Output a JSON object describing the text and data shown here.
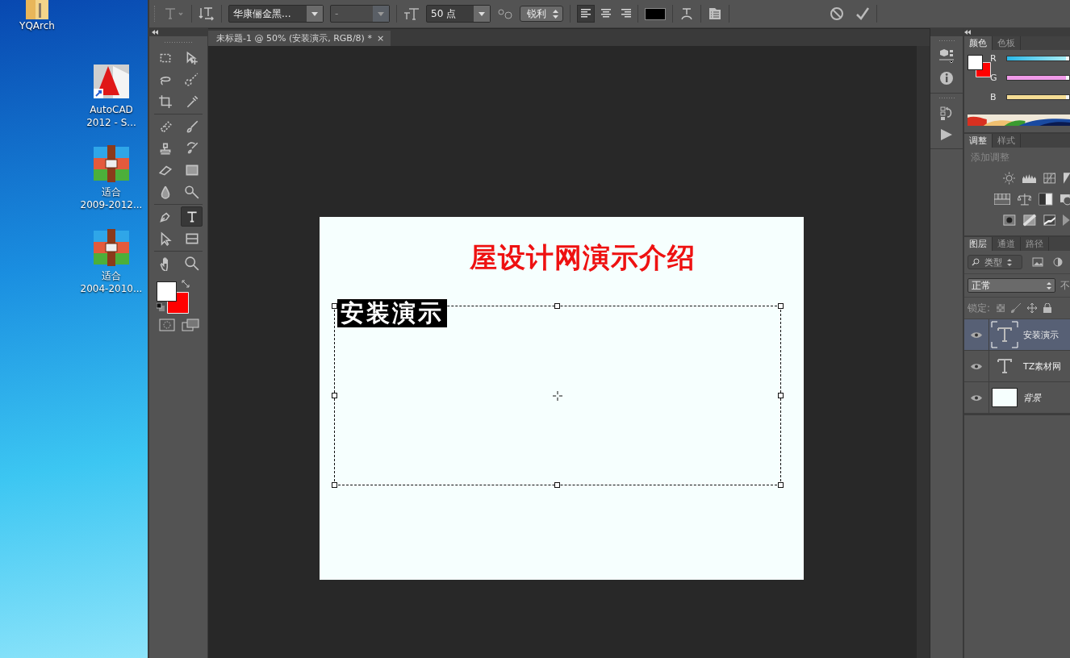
{
  "desktop": {
    "icons": [
      {
        "kind": "folder",
        "lines": [
          "YQArch"
        ]
      },
      {
        "kind": "autocad",
        "lines": [
          "AutoCAD",
          "2012 - S..."
        ]
      },
      {
        "kind": "archive",
        "lines": [
          "适合",
          "2009-2012..."
        ]
      },
      {
        "kind": "archive",
        "lines": [
          "适合",
          "2004-2010..."
        ]
      }
    ]
  },
  "options_bar": {
    "font_family": "华康俪金黑...",
    "font_style": "-",
    "font_size": "50 点",
    "antialias": "锐利",
    "align": [
      {
        "kind": "left",
        "selected": true
      },
      {
        "kind": "center",
        "selected": false
      },
      {
        "kind": "right",
        "selected": false
      }
    ]
  },
  "document_tab": {
    "title": "未标题-1 @ 50% (安装演示, RGB/8) *",
    "close": "×"
  },
  "tools": [
    {
      "kind": "marquee",
      "selected": false
    },
    {
      "kind": "move",
      "selected": false
    },
    {
      "kind": "lasso",
      "selected": false
    },
    {
      "kind": "quickselect",
      "selected": false
    },
    {
      "kind": "crop",
      "selected": false
    },
    {
      "kind": "eyedropper",
      "selected": false
    },
    {
      "kind": "healing",
      "selected": false
    },
    {
      "kind": "brush",
      "selected": false
    },
    {
      "kind": "stamp",
      "selected": false
    },
    {
      "kind": "historybrush",
      "selected": false
    },
    {
      "kind": "eraser",
      "selected": false
    },
    {
      "kind": "gradient",
      "selected": false
    },
    {
      "kind": "blur",
      "selected": false
    },
    {
      "kind": "dodge",
      "selected": false
    },
    {
      "kind": "pen",
      "selected": false
    },
    {
      "kind": "type",
      "selected": true
    },
    {
      "kind": "pathselect",
      "selected": false
    },
    {
      "kind": "rectangle",
      "selected": false
    },
    {
      "kind": "hand",
      "selected": false
    },
    {
      "kind": "zoom",
      "selected": false
    }
  ],
  "canvas": {
    "heading": "屋设计网演示介绍",
    "selected_text": "安装演示"
  },
  "color_panel": {
    "tabs": [
      {
        "label": "颜色",
        "selected": true
      },
      {
        "label": "色板",
        "selected": false
      }
    ],
    "channels": [
      {
        "label": "R",
        "level": 0.95
      },
      {
        "label": "G",
        "level": 0.95
      },
      {
        "label": "B",
        "level": 0.95
      }
    ]
  },
  "adjustments_panel": {
    "tabs": [
      {
        "label": "调整",
        "selected": true
      },
      {
        "label": "样式",
        "selected": false
      }
    ],
    "hint": "添加调整"
  },
  "layers_panel": {
    "tabs": [
      {
        "label": "图层",
        "selected": true
      },
      {
        "label": "通道",
        "selected": false
      },
      {
        "label": "路径",
        "selected": false
      }
    ],
    "filter": "类型",
    "blend_mode": "正常",
    "opacity_label": "不",
    "lock_label": "锁定:",
    "layers": [
      {
        "name": "安装演示",
        "kind": "text",
        "selected": true,
        "visible": true
      },
      {
        "name": "TZ素材网",
        "kind": "text",
        "selected": false,
        "visible": true
      },
      {
        "name": "背景",
        "kind": "image",
        "selected": false,
        "visible": true
      }
    ]
  }
}
